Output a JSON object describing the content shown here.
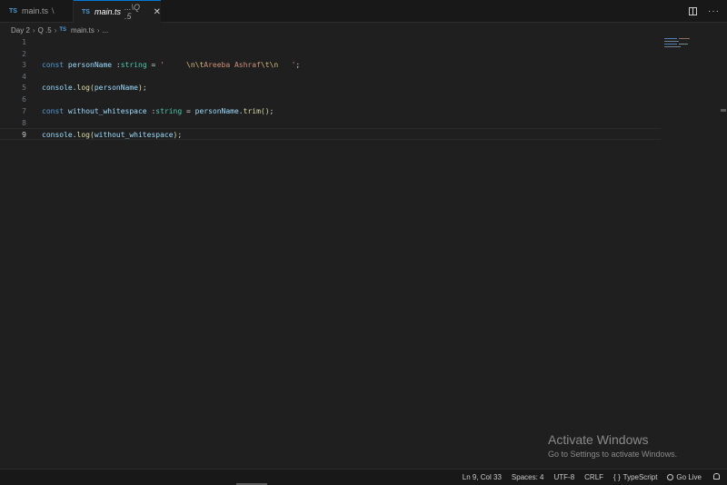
{
  "tabs": [
    {
      "badge": "TS",
      "name": "main.ts",
      "path": "\\"
    },
    {
      "badge": "TS",
      "name": "main.ts",
      "path": "...\\Q .5",
      "close": "✕"
    }
  ],
  "breadcrumb": {
    "items": [
      "Day 2",
      "Q .5",
      "main.ts",
      "..."
    ],
    "badge": "TS"
  },
  "editor": {
    "current_line": 9,
    "lines": [
      {
        "n": "1"
      },
      {
        "n": "2"
      },
      {
        "n": "3"
      },
      {
        "n": "4"
      },
      {
        "n": "5"
      },
      {
        "n": "6"
      },
      {
        "n": "7"
      },
      {
        "n": "8"
      },
      {
        "n": "9"
      }
    ],
    "code": {
      "l3": {
        "kw": "const",
        "var": "personName",
        "colon": " :",
        "type": "string",
        "eq": " = ",
        "q1": "'     ",
        "esc1": "\\n\\t",
        "txt": "Areeba Ashraf",
        "esc2": "\\t\\n",
        "q2": "   '",
        "semi": ";"
      },
      "l5": {
        "obj": "console",
        "dot": ".",
        "fn": "log",
        "open": "(",
        "arg": "personName",
        "close": ")",
        "semi": ";"
      },
      "l7": {
        "kw": "const",
        "var": "without_whitespace",
        "colon": " :",
        "type": "string",
        "eq": " = ",
        "obj": "personName",
        "dot": ".",
        "fn": "trim",
        "parens": "()",
        "semi": ";"
      },
      "l9": {
        "obj": "console",
        "dot": ".",
        "fn": "log",
        "open": "(",
        "arg": "without_whitespace",
        "close": ")",
        "semi": ";"
      }
    }
  },
  "watermark": {
    "title": "Activate Windows",
    "subtitle": "Go to Settings to activate Windows."
  },
  "status": {
    "position": "Ln 9, Col 33",
    "spaces": "Spaces: 4",
    "encoding": "UTF-8",
    "eol": "CRLF",
    "language_braces": "{ }",
    "language": "TypeScript",
    "golive": "Go Live"
  },
  "colors": {
    "accent": "#0078d4",
    "keyword": "#569cd6",
    "variable": "#9cdcfe",
    "type": "#4ec9b0",
    "string": "#ce9178",
    "function": "#dcdcaa"
  },
  "icons": [
    "split-editor-icon",
    "more-actions-icon",
    "close-icon",
    "chevron-right-icon",
    "bell-icon",
    "golive-icon"
  ]
}
